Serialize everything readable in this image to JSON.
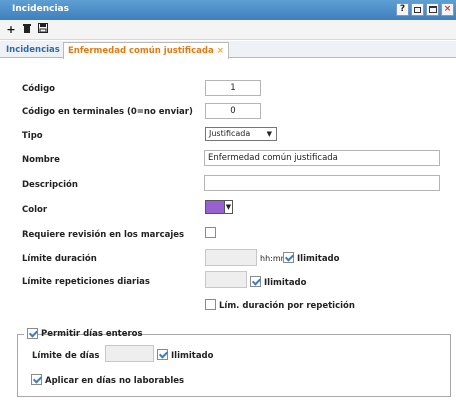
{
  "window": {
    "title": "Incidencias",
    "buttons": [
      "?",
      "",
      "",
      "×"
    ]
  },
  "toolbar": {
    "add": "+",
    "delete": "🗑",
    "save": "💾"
  },
  "tabs": [
    {
      "label": "Incidencias"
    },
    {
      "label": "Enfermedad común justificada",
      "close": "×"
    }
  ],
  "form": {
    "codigo": {
      "label": "Código",
      "value": "1"
    },
    "codigo_terminales": {
      "label": "Código en terminales (0=no enviar)",
      "value": "0"
    },
    "tipo": {
      "label": "Tipo",
      "selected": "Justificada"
    },
    "nombre": {
      "label": "Nombre",
      "value": "Enfermedad común justificada"
    },
    "descripcion": {
      "label": "Descripción",
      "value": ""
    },
    "color": {
      "label": "Color",
      "value": "#9a5fd0"
    },
    "requiere_revision": {
      "label": "Requiere revisión en los marcajes",
      "checked": false
    },
    "limite_duracion": {
      "label": "Límite duración",
      "value": "",
      "unit": "hh:mm",
      "ilimitado_label": "Ilimitado",
      "ilimitado": true
    },
    "limite_repeticiones": {
      "label": "Límite repeticiones diarias",
      "value": "",
      "ilimitado_label": "Ilimitado",
      "ilimitado": true
    },
    "lim_duracion_repeticion": {
      "label": "Lím. duración por repetición",
      "checked": false
    }
  },
  "dias_enteros": {
    "legend": "Permitir días enteros",
    "checked": true,
    "limite_dias": {
      "label": "Límite de días",
      "value": "",
      "ilimitado_label": "Ilimitado",
      "ilimitado": true
    },
    "no_laborables": {
      "label": "Aplicar en días no laborables",
      "checked": true
    }
  }
}
